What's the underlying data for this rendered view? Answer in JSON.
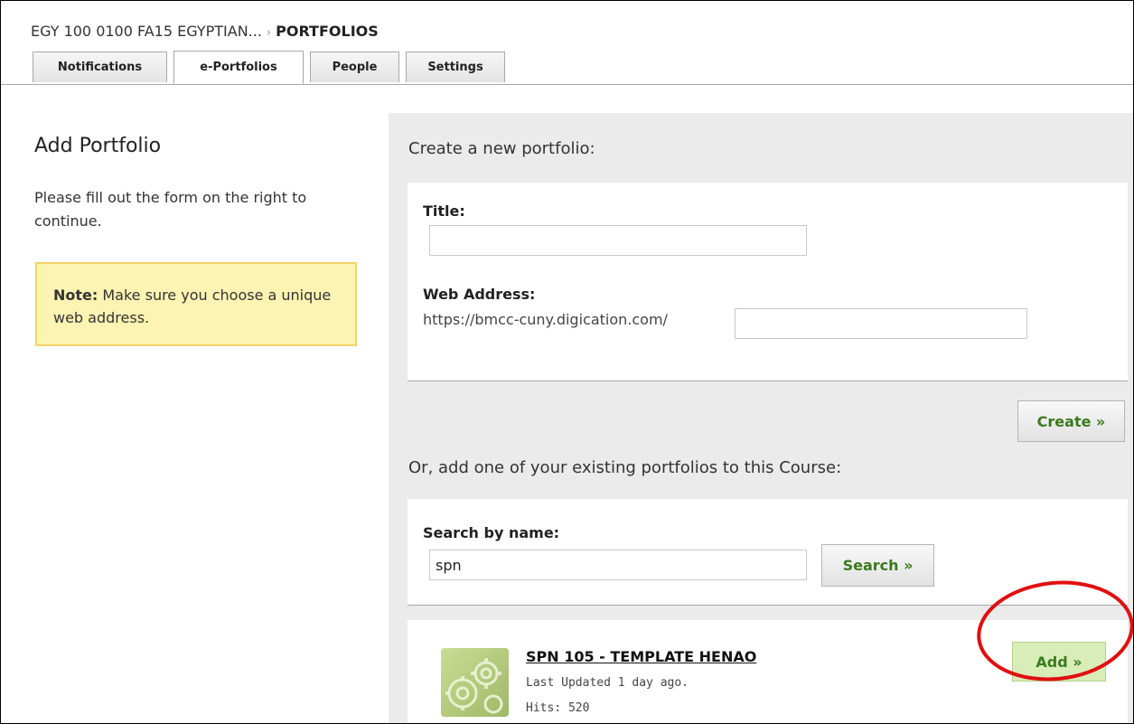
{
  "breadcrumb": {
    "course": "EGY 100 0100 FA15 EGYPTIAN...",
    "separator": "›",
    "current": "PORTFOLIOS"
  },
  "tabs": [
    {
      "label": "Notifications",
      "active": false
    },
    {
      "label": "e-Portfolios",
      "active": true
    },
    {
      "label": "People",
      "active": false
    },
    {
      "label": "Settings",
      "active": false
    }
  ],
  "left": {
    "title": "Add Portfolio",
    "description": "Please fill out the form on the right to continue.",
    "note_label": "Note:",
    "note_text": " Make sure you choose a unique web address."
  },
  "create": {
    "heading": "Create a new portfolio:",
    "title_label": "Title:",
    "title_value": "",
    "web_label": "Web Address:",
    "web_prefix": "https://bmcc-cuny.digication.com/",
    "web_value": "",
    "button": "Create »"
  },
  "existing": {
    "heading": "Or, add one of your existing portfolios to this Course:",
    "search_label": "Search by name:",
    "search_value": "spn",
    "search_button": "Search »"
  },
  "result": {
    "title": "SPN 105 - TEMPLATE HENAO",
    "updated": "Last Updated 1 day ago.",
    "hits": "Hits: 520",
    "add_button": "Add »"
  },
  "colors": {
    "accent_green": "#3a7a1e",
    "note_bg": "#fdf3b2",
    "annotation_red": "#e01010"
  }
}
